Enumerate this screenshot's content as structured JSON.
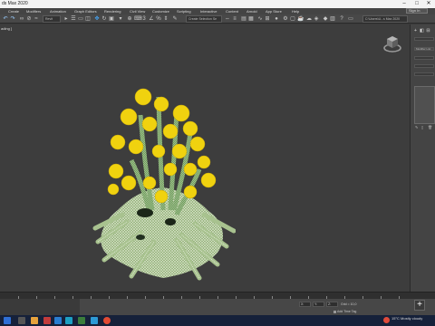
{
  "titlebar": {
    "title": "ds Max 2020",
    "minimize": "–",
    "maximize": "□",
    "close": "✕"
  },
  "menubar": {
    "items": [
      "Create",
      "Modifiers",
      "Animation",
      "Graph Editors",
      "Rendering",
      "Civil View",
      "Customize",
      "Scripting",
      "Interactive",
      "Content",
      "Arnold",
      "App Store",
      "Help"
    ],
    "sign_in": "Sign In"
  },
  "toolbar": {
    "selection_filter": "Revit",
    "named_selection": "Create Selection Se",
    "project_path": "C:\\Users\\U...s Max 2020"
  },
  "viewport": {
    "label": "ading ]"
  },
  "command_panel": {
    "modifier_list": "Modifier List"
  },
  "status": {
    "coord_x": "X:",
    "coord_y": "Y:",
    "coord_z": "Z:",
    "grid": "Grid = 10,0",
    "add_time_tag": "Add Time Tag"
  },
  "taskbar": {
    "weather": "15°C  Mostly cloudy"
  },
  "colors": {
    "viewport_bg": "#3d3d3d",
    "flower": "#f0d20f",
    "foliage": "#8fae74",
    "taskbar": "#16213a"
  }
}
